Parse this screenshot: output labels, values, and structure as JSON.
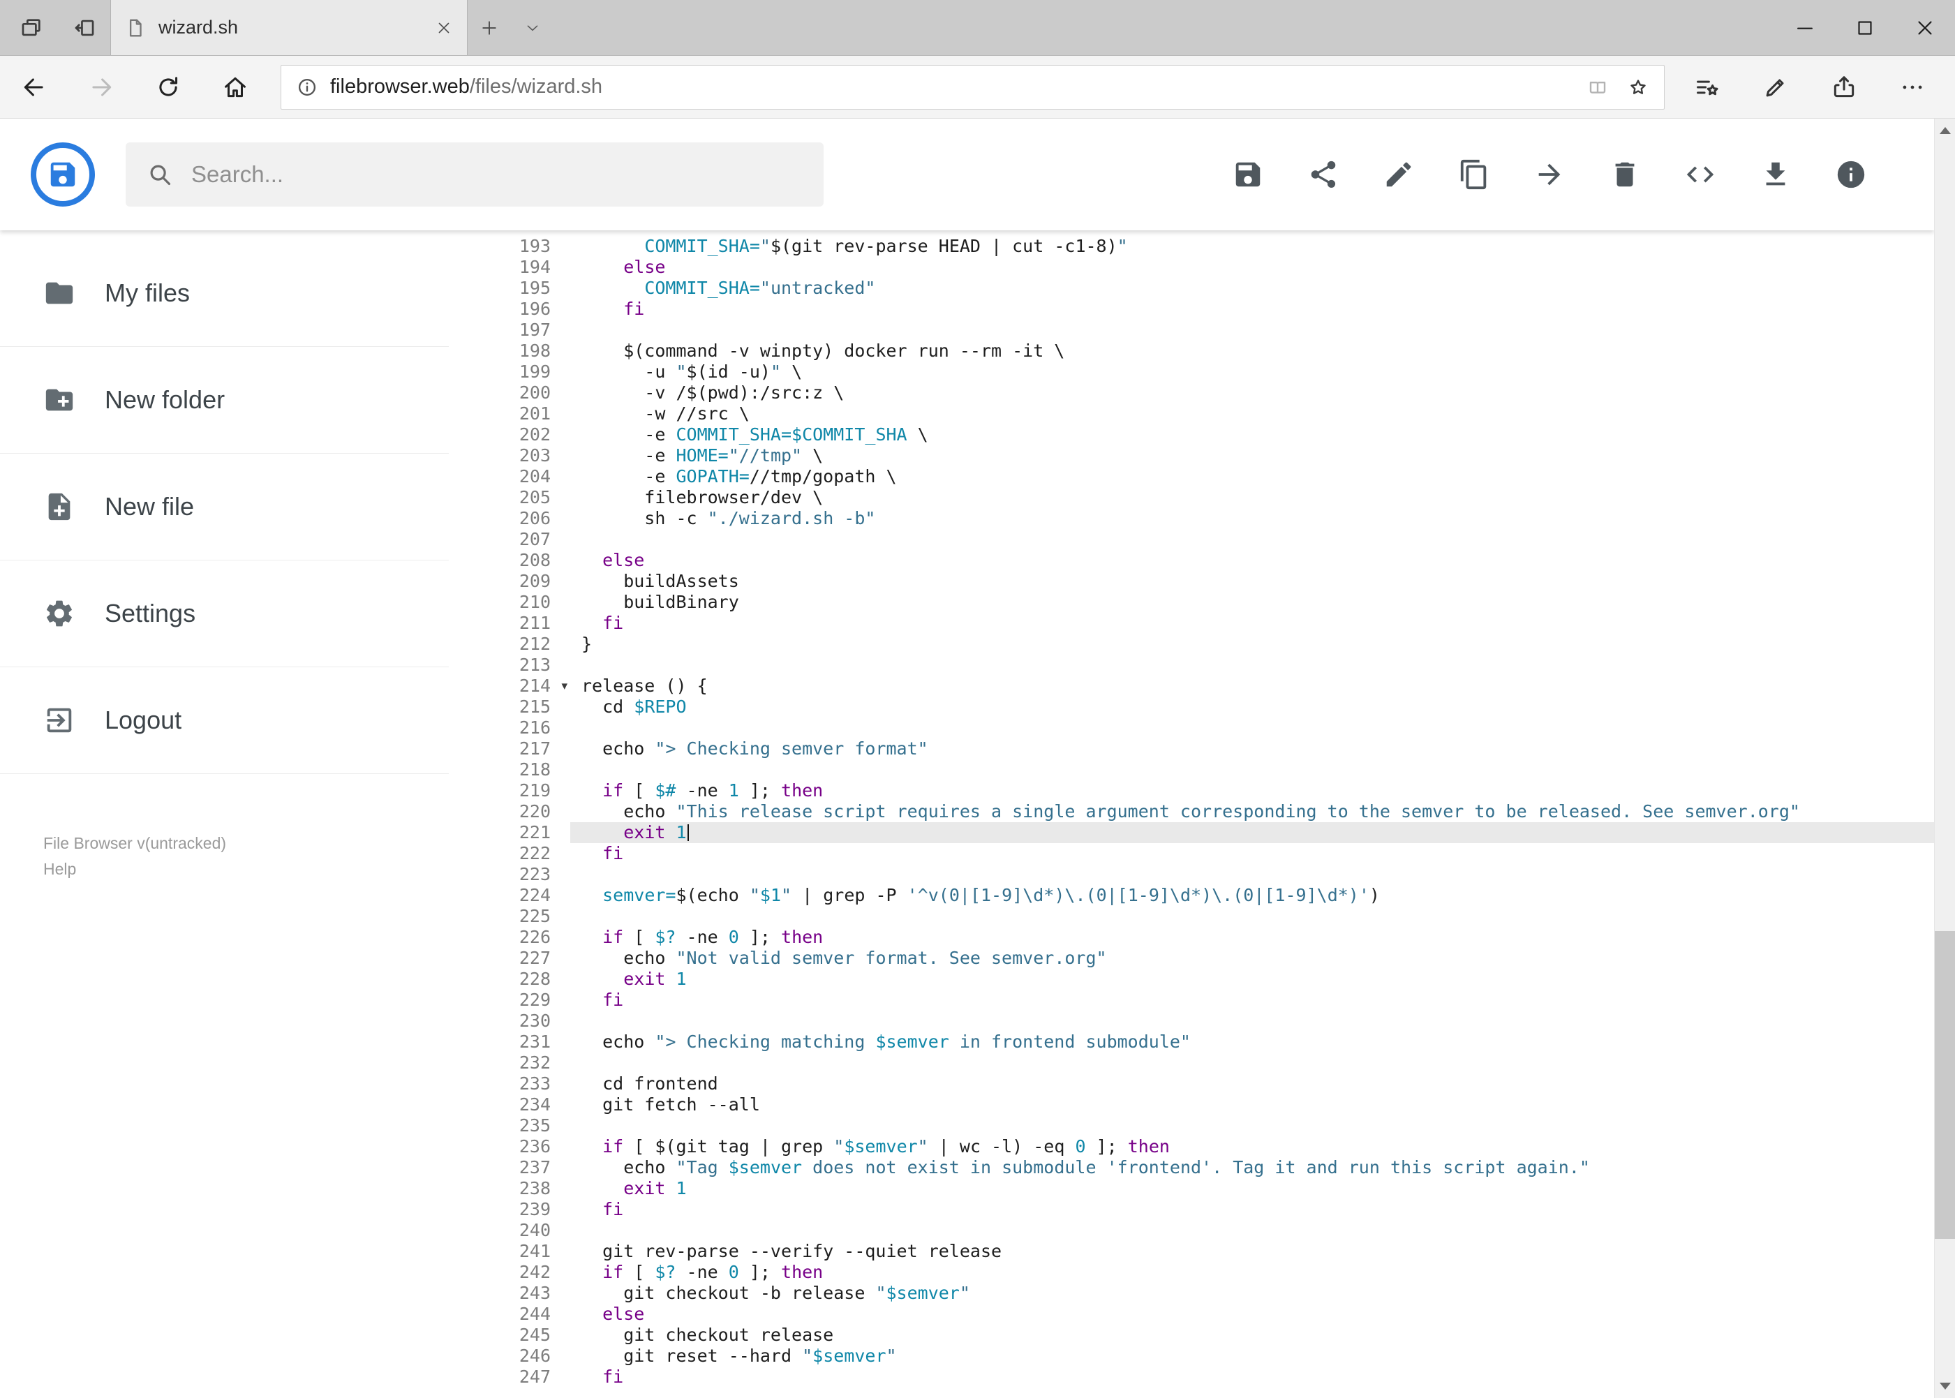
{
  "browser": {
    "tab_title": "wizard.sh",
    "tabstrip_icons": [
      "tab-preview-icon",
      "set-tabs-aside-icon",
      "new-tab-icon",
      "tab-dropdown-icon"
    ],
    "window_controls": [
      "minimize-icon",
      "maximize-icon",
      "close-icon"
    ],
    "nav_icons": [
      "back-icon",
      "forward-icon",
      "refresh-icon",
      "home-icon"
    ],
    "address": {
      "domain": "filebrowser.web",
      "path": "/files/wizard.sh",
      "icons": [
        "page-info-icon",
        "reading-view-icon",
        "favorite-star-icon"
      ]
    },
    "toolbar_icons": [
      "hub-icon",
      "annotate-icon",
      "share-icon",
      "more-icon"
    ]
  },
  "header": {
    "search_placeholder": "Search...",
    "actions": [
      "save-icon",
      "share-icon",
      "edit-icon",
      "copy-icon",
      "move-icon",
      "delete-icon",
      "code-icon",
      "download-icon",
      "info-icon"
    ]
  },
  "sidebar": {
    "items": [
      {
        "label": "My files",
        "icon": "folder-icon"
      },
      {
        "label": "New folder",
        "icon": "new-folder-icon"
      },
      {
        "label": "New file",
        "icon": "new-file-icon"
      },
      {
        "label": "Settings",
        "icon": "settings-icon"
      },
      {
        "label": "Logout",
        "icon": "logout-icon"
      }
    ],
    "footer": {
      "version": "File Browser v(untracked)",
      "help": "Help"
    }
  },
  "colors": {
    "accent_blue": "#2a7cdf",
    "active_line": "#e9e9e9",
    "keyword": "#770088",
    "variable": "#0f87a8",
    "string": "#35708e"
  },
  "editor": {
    "first_line": 193,
    "last_line": 247,
    "active_line": 221,
    "folded_line": 214,
    "lines": [
      {
        "n": 193,
        "t": [
          [
            "p",
            "      "
          ],
          [
            "v",
            "COMMIT_SHA="
          ],
          [
            "s",
            "\""
          ],
          [
            "p",
            "$(git rev-parse HEAD | cut -c1-8)"
          ],
          [
            "s",
            "\""
          ]
        ]
      },
      {
        "n": 194,
        "t": [
          [
            "p",
            "    "
          ],
          [
            "k",
            "else"
          ]
        ]
      },
      {
        "n": 195,
        "t": [
          [
            "p",
            "      "
          ],
          [
            "v",
            "COMMIT_SHA="
          ],
          [
            "s",
            "\"untracked\""
          ]
        ]
      },
      {
        "n": 196,
        "t": [
          [
            "p",
            "    "
          ],
          [
            "k",
            "fi"
          ]
        ]
      },
      {
        "n": 197,
        "t": []
      },
      {
        "n": 198,
        "t": [
          [
            "p",
            "    $(command -v winpty) docker run --rm -it \\"
          ]
        ]
      },
      {
        "n": 199,
        "t": [
          [
            "p",
            "      -u "
          ],
          [
            "s",
            "\""
          ],
          [
            "p",
            "$(id -u)"
          ],
          [
            "s",
            "\""
          ],
          [
            "p",
            " \\"
          ]
        ]
      },
      {
        "n": 200,
        "t": [
          [
            "p",
            "      -v /$(pwd):/src:z \\"
          ]
        ]
      },
      {
        "n": 201,
        "t": [
          [
            "p",
            "      -w //src \\"
          ]
        ]
      },
      {
        "n": 202,
        "t": [
          [
            "p",
            "      -e "
          ],
          [
            "v",
            "COMMIT_SHA=$COMMIT_SHA"
          ],
          [
            "p",
            " \\"
          ]
        ]
      },
      {
        "n": 203,
        "t": [
          [
            "p",
            "      -e "
          ],
          [
            "v",
            "HOME="
          ],
          [
            "s",
            "\"//tmp\""
          ],
          [
            "p",
            " \\"
          ]
        ]
      },
      {
        "n": 204,
        "t": [
          [
            "p",
            "      -e "
          ],
          [
            "v",
            "GOPATH="
          ],
          [
            "p",
            "//tmp/gopath \\"
          ]
        ]
      },
      {
        "n": 205,
        "t": [
          [
            "p",
            "      filebrowser/dev \\"
          ]
        ]
      },
      {
        "n": 206,
        "t": [
          [
            "p",
            "      sh -c "
          ],
          [
            "s",
            "\"./wizard.sh -b\""
          ]
        ]
      },
      {
        "n": 207,
        "t": []
      },
      {
        "n": 208,
        "t": [
          [
            "p",
            "  "
          ],
          [
            "k",
            "else"
          ]
        ]
      },
      {
        "n": 209,
        "t": [
          [
            "p",
            "    buildAssets"
          ]
        ]
      },
      {
        "n": 210,
        "t": [
          [
            "p",
            "    buildBinary"
          ]
        ]
      },
      {
        "n": 211,
        "t": [
          [
            "p",
            "  "
          ],
          [
            "k",
            "fi"
          ]
        ]
      },
      {
        "n": 212,
        "t": [
          [
            "p",
            "}"
          ]
        ]
      },
      {
        "n": 213,
        "t": []
      },
      {
        "n": 214,
        "fold": true,
        "t": [
          [
            "p",
            "release () {"
          ]
        ]
      },
      {
        "n": 215,
        "t": [
          [
            "p",
            "  cd "
          ],
          [
            "v",
            "$REPO"
          ]
        ]
      },
      {
        "n": 216,
        "t": []
      },
      {
        "n": 217,
        "t": [
          [
            "p",
            "  echo "
          ],
          [
            "s",
            "\"> Checking semver format\""
          ]
        ]
      },
      {
        "n": 218,
        "t": []
      },
      {
        "n": 219,
        "t": [
          [
            "p",
            "  "
          ],
          [
            "k",
            "if"
          ],
          [
            "p",
            " [ "
          ],
          [
            "v",
            "$#"
          ],
          [
            "p",
            " -ne "
          ],
          [
            "n",
            "1"
          ],
          [
            "p",
            " ]; "
          ],
          [
            "k",
            "then"
          ]
        ]
      },
      {
        "n": 220,
        "t": [
          [
            "p",
            "    echo "
          ],
          [
            "s",
            "\"This release script requires a single argument corresponding to the semver to be released. See semver.org\""
          ]
        ]
      },
      {
        "n": 221,
        "active": true,
        "cursor": true,
        "t": [
          [
            "p",
            "    "
          ],
          [
            "k",
            "exit"
          ],
          [
            "p",
            " "
          ],
          [
            "n",
            "1"
          ]
        ]
      },
      {
        "n": 222,
        "t": [
          [
            "p",
            "  "
          ],
          [
            "k",
            "fi"
          ]
        ]
      },
      {
        "n": 223,
        "t": []
      },
      {
        "n": 224,
        "t": [
          [
            "p",
            "  "
          ],
          [
            "v",
            "semver="
          ],
          [
            "p",
            "$(echo "
          ],
          [
            "s",
            "\""
          ],
          [
            "v",
            "$1"
          ],
          [
            "s",
            "\""
          ],
          [
            "p",
            " | grep -P "
          ],
          [
            "s",
            "'^v(0|[1-9]\\d*)\\.(0|[1-9]\\d*)\\.(0|[1-9]\\d*)'"
          ],
          [
            "p",
            ")"
          ]
        ]
      },
      {
        "n": 225,
        "t": []
      },
      {
        "n": 226,
        "t": [
          [
            "p",
            "  "
          ],
          [
            "k",
            "if"
          ],
          [
            "p",
            " [ "
          ],
          [
            "v",
            "$?"
          ],
          [
            "p",
            " -ne "
          ],
          [
            "n",
            "0"
          ],
          [
            "p",
            " ]; "
          ],
          [
            "k",
            "then"
          ]
        ]
      },
      {
        "n": 227,
        "t": [
          [
            "p",
            "    echo "
          ],
          [
            "s",
            "\"Not valid semver format. See semver.org\""
          ]
        ]
      },
      {
        "n": 228,
        "t": [
          [
            "p",
            "    "
          ],
          [
            "k",
            "exit"
          ],
          [
            "p",
            " "
          ],
          [
            "n",
            "1"
          ]
        ]
      },
      {
        "n": 229,
        "t": [
          [
            "p",
            "  "
          ],
          [
            "k",
            "fi"
          ]
        ]
      },
      {
        "n": 230,
        "t": []
      },
      {
        "n": 231,
        "t": [
          [
            "p",
            "  echo "
          ],
          [
            "s",
            "\"> Checking matching "
          ],
          [
            "v",
            "$semver"
          ],
          [
            "s",
            " in frontend submodule\""
          ]
        ]
      },
      {
        "n": 232,
        "t": []
      },
      {
        "n": 233,
        "t": [
          [
            "p",
            "  cd frontend"
          ]
        ]
      },
      {
        "n": 234,
        "t": [
          [
            "p",
            "  git fetch --all"
          ]
        ]
      },
      {
        "n": 235,
        "t": []
      },
      {
        "n": 236,
        "t": [
          [
            "p",
            "  "
          ],
          [
            "k",
            "if"
          ],
          [
            "p",
            " [ $(git tag | grep "
          ],
          [
            "s",
            "\""
          ],
          [
            "v",
            "$semver"
          ],
          [
            "s",
            "\""
          ],
          [
            "p",
            " | wc -l) -eq "
          ],
          [
            "n",
            "0"
          ],
          [
            "p",
            " ]; "
          ],
          [
            "k",
            "then"
          ]
        ]
      },
      {
        "n": 237,
        "t": [
          [
            "p",
            "    echo "
          ],
          [
            "s",
            "\"Tag "
          ],
          [
            "v",
            "$semver"
          ],
          [
            "s",
            " does not exist in submodule 'frontend'. Tag it and run this script again.\""
          ]
        ]
      },
      {
        "n": 238,
        "t": [
          [
            "p",
            "    "
          ],
          [
            "k",
            "exit"
          ],
          [
            "p",
            " "
          ],
          [
            "n",
            "1"
          ]
        ]
      },
      {
        "n": 239,
        "t": [
          [
            "p",
            "  "
          ],
          [
            "k",
            "fi"
          ]
        ]
      },
      {
        "n": 240,
        "t": []
      },
      {
        "n": 241,
        "t": [
          [
            "p",
            "  git rev-parse --verify --quiet release"
          ]
        ]
      },
      {
        "n": 242,
        "t": [
          [
            "p",
            "  "
          ],
          [
            "k",
            "if"
          ],
          [
            "p",
            " [ "
          ],
          [
            "v",
            "$?"
          ],
          [
            "p",
            " -ne "
          ],
          [
            "n",
            "0"
          ],
          [
            "p",
            " ]; "
          ],
          [
            "k",
            "then"
          ]
        ]
      },
      {
        "n": 243,
        "t": [
          [
            "p",
            "    git checkout -b release "
          ],
          [
            "s",
            "\""
          ],
          [
            "v",
            "$semver"
          ],
          [
            "s",
            "\""
          ]
        ]
      },
      {
        "n": 244,
        "t": [
          [
            "p",
            "  "
          ],
          [
            "k",
            "else"
          ]
        ]
      },
      {
        "n": 245,
        "t": [
          [
            "p",
            "    git checkout release"
          ]
        ]
      },
      {
        "n": 246,
        "t": [
          [
            "p",
            "    git reset --hard "
          ],
          [
            "s",
            "\""
          ],
          [
            "v",
            "$semver"
          ],
          [
            "s",
            "\""
          ]
        ]
      },
      {
        "n": 247,
        "t": [
          [
            "p",
            "  "
          ],
          [
            "k",
            "fi"
          ]
        ]
      }
    ]
  }
}
